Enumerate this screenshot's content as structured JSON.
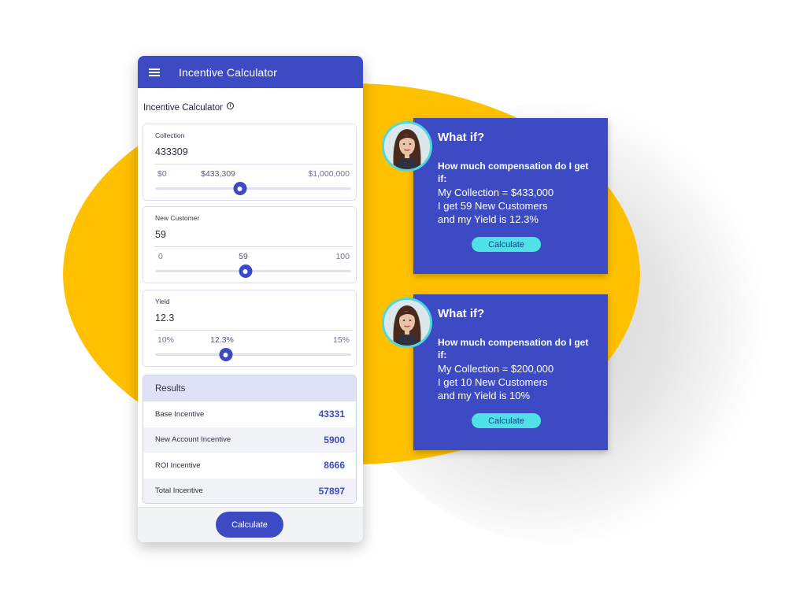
{
  "app": {
    "title": "Incentive Calculator",
    "section_title": "Incentive Calculator",
    "info_symbol": "i"
  },
  "sliders": [
    {
      "label": "Collection",
      "value": "433309",
      "min_label": "$0",
      "current_label": "$433,309",
      "max_label": "$1,000,000",
      "fraction": 0.433
    },
    {
      "label": "New Customer",
      "value": "59",
      "min_label": "0",
      "current_label": "59",
      "max_label": "100",
      "fraction": 0.46
    },
    {
      "label": "Yield",
      "value": "12.3",
      "min_label": "10%",
      "current_label": "12.3%",
      "max_label": "15%",
      "fraction": 0.36
    }
  ],
  "results": {
    "header": "Results",
    "rows": [
      {
        "label": "Base Incentive",
        "value": "43331"
      },
      {
        "label": "New Account Incentive",
        "value": "5900"
      },
      {
        "label": "ROI Incentive",
        "value": "8666"
      },
      {
        "label": "Total Incentive",
        "value": "57897"
      }
    ]
  },
  "footer": {
    "calculate_label": "Calculate"
  },
  "what_if_cards": [
    {
      "title": "What if?",
      "question": "How much compensation do I get if:",
      "lines": [
        "My Collection = $433,000",
        "I get 59 New Customers",
        "and my Yield is 12.3%"
      ],
      "button": "Calculate"
    },
    {
      "title": "What if?",
      "question": "How much compensation do I get if:",
      "lines": [
        "My Collection = $200,000",
        "I get 10 New Customers",
        "and my Yield is 10%"
      ],
      "button": "Calculate"
    }
  ],
  "colors": {
    "primary": "#3c4bc3",
    "accent_cyan": "#4fe1e5",
    "blob_yellow": "#ffc000"
  }
}
